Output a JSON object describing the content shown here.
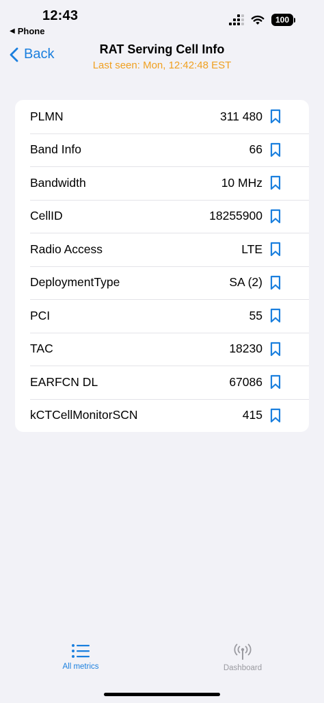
{
  "status_bar": {
    "time": "12:43",
    "back_app": "Phone",
    "battery": "100"
  },
  "nav": {
    "back_label": "Back",
    "title": "RAT Serving Cell Info",
    "subtitle": "Last seen: Mon, 12:42:48 EST"
  },
  "rows": [
    {
      "label": "PLMN",
      "value": "311 480"
    },
    {
      "label": "Band Info",
      "value": "66"
    },
    {
      "label": "Bandwidth",
      "value": "10 MHz"
    },
    {
      "label": "CellID",
      "value": "18255900"
    },
    {
      "label": "Radio Access",
      "value": "LTE"
    },
    {
      "label": "DeploymentType",
      "value": "SA (2)"
    },
    {
      "label": "PCI",
      "value": "55"
    },
    {
      "label": "TAC",
      "value": "18230"
    },
    {
      "label": "EARFCN DL",
      "value": "67086"
    },
    {
      "label": "kCTCellMonitorSCN",
      "value": "415"
    }
  ],
  "tabs": [
    {
      "label": "All metrics",
      "icon": "list-icon",
      "active": true
    },
    {
      "label": "Dashboard",
      "icon": "antenna-icon",
      "active": false
    }
  ],
  "colors": {
    "accent": "#1a7fde",
    "subtitle": "#f0a020",
    "background": "#f2f2f7",
    "inactive": "#9a9aa0"
  }
}
